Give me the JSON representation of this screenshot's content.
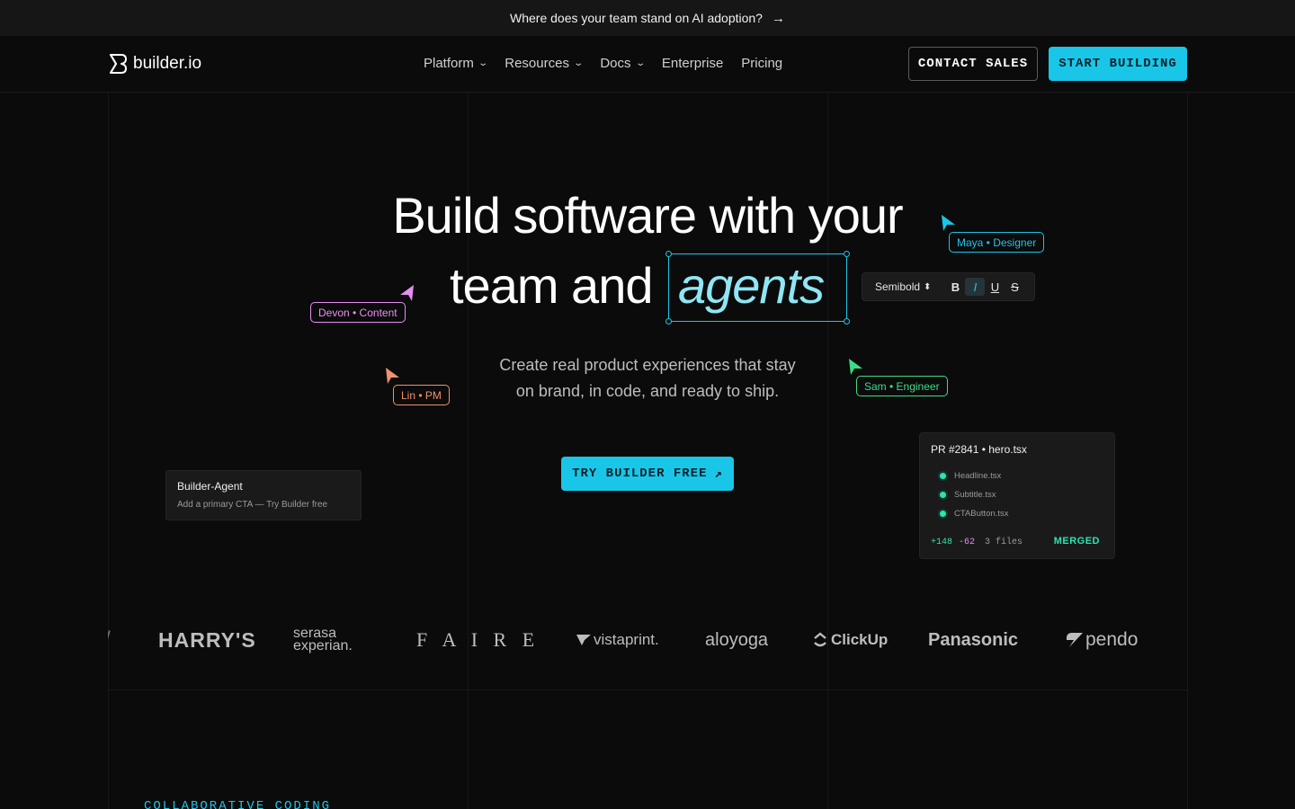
{
  "banner": {
    "text": "Where does your team stand on AI adoption?",
    "arrow": "→"
  },
  "nav": {
    "logo_text": "builder.io",
    "menu": [
      {
        "label": "Platform",
        "has_dropdown": true
      },
      {
        "label": "Resources",
        "has_dropdown": true
      },
      {
        "label": "Docs",
        "has_dropdown": true
      },
      {
        "label": "Enterprise",
        "has_dropdown": false
      },
      {
        "label": "Pricing",
        "has_dropdown": false
      }
    ],
    "chevron": "⌄",
    "contact_label": "CONTACT SALES",
    "start_label": "START BUILDING"
  },
  "hero": {
    "line1": "Build software with your",
    "line2_prefix": "team and",
    "line2_highlight": "agents",
    "subtitle_line1": "Create real product experiences that stay",
    "subtitle_line2": "on brand, in code, and ready to ship.",
    "cta_label": "TRY BUILDER FREE",
    "cta_icon": "↗"
  },
  "toolbar": {
    "font_label": "Semibold",
    "font_caret": "⬍",
    "buttons": [
      "B",
      "I",
      "U",
      "S"
    ]
  },
  "collaborators": [
    {
      "label": "Maya • Designer",
      "color": "#19c6e8"
    },
    {
      "label": "Devon • Content",
      "color": "#e58ff0"
    },
    {
      "label": "Lin • PM",
      "color": "#f2916b"
    },
    {
      "label": "Sam • Engineer",
      "color": "#3ddc84"
    }
  ],
  "agent_card": {
    "title": "Builder-Agent",
    "desc": "Add a primary CTA — Try Builder free"
  },
  "pr_card": {
    "title": "PR #2841 • hero.tsx",
    "files": [
      "Headline.tsx",
      "Subtitle.tsx",
      "CTAButton.tsx"
    ],
    "additions": "+148",
    "deletions": "-62",
    "files_count": "3 files",
    "status": "MERGED"
  },
  "logos": [
    "/",
    "HARRY'S",
    "serasa experian.",
    "F A I R E",
    "vistaprint.",
    "aloyoga",
    "ClickUp",
    "Panasonic",
    "pendo"
  ],
  "section": {
    "eyebrow": "COLLABORATIVE CODING"
  },
  "colors": {
    "accent": "#19c6e8",
    "merged": "#2ee3b0",
    "additions": "#2ee3b0",
    "deletions": "#e58ff0"
  }
}
